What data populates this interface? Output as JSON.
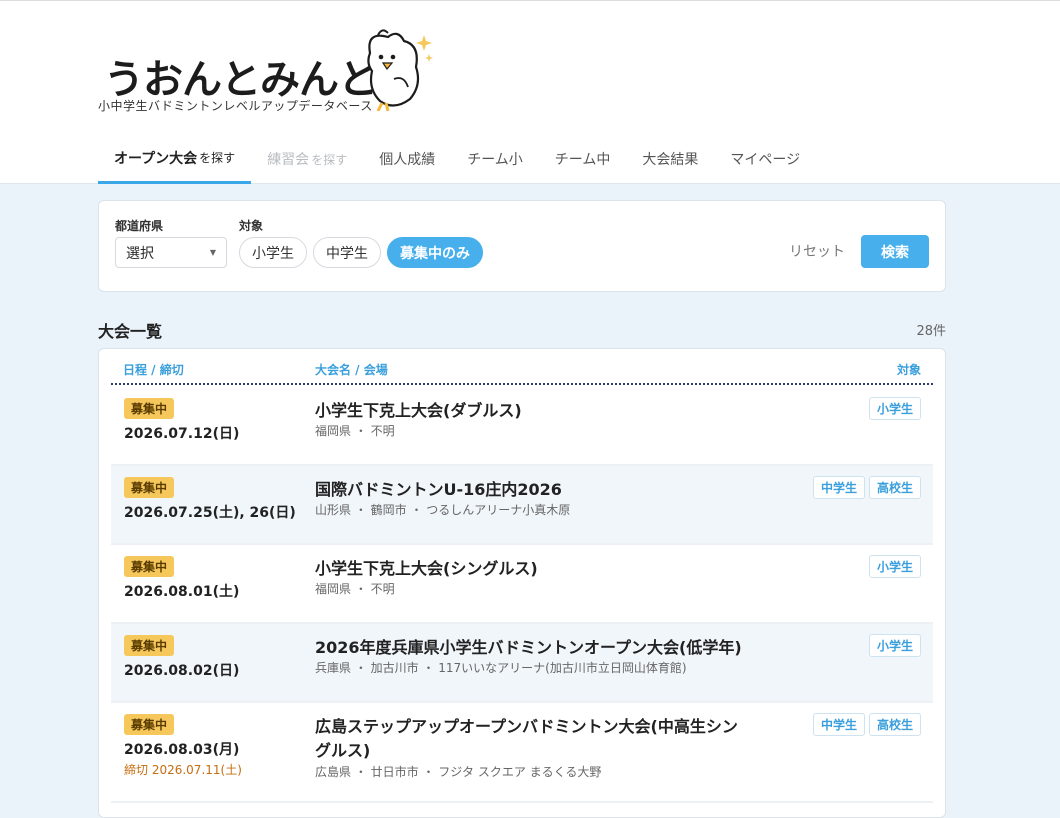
{
  "brand": {
    "logo_text": "うおんとみんとん",
    "subtitle": "小中学生バドミントンレベルアップデータベース"
  },
  "nav": [
    {
      "main": "オープン大会",
      "suffix": "を探す",
      "state": "active"
    },
    {
      "main": "練習会",
      "suffix": "を探す",
      "state": "disabled"
    },
    {
      "main": "個人成績",
      "suffix": "",
      "state": "normal"
    },
    {
      "main": "チーム小",
      "suffix": "",
      "state": "normal"
    },
    {
      "main": "チーム中",
      "suffix": "",
      "state": "normal"
    },
    {
      "main": "大会結果",
      "suffix": "",
      "state": "normal"
    },
    {
      "main": "マイページ",
      "suffix": "",
      "state": "normal"
    }
  ],
  "filter": {
    "prefecture_label": "都道府県",
    "prefecture_value": "選択",
    "target_label": "対象",
    "chips": [
      {
        "label": "小学生",
        "selected": false
      },
      {
        "label": "中学生",
        "selected": false
      },
      {
        "label": "募集中のみ",
        "selected": true
      }
    ],
    "reset_label": "リセット",
    "search_label": "検索"
  },
  "list": {
    "title": "大会一覧",
    "count": "28件",
    "headers": {
      "date": "日程 / 締切",
      "name": "大会名 / 会場",
      "target": "対象"
    },
    "rows": [
      {
        "badge": "募集中",
        "date": "2026.07.12(日)",
        "deadline": "",
        "name": "小学生下克上大会(ダブルス)",
        "venue": "福岡県 ・ 不明",
        "tags": [
          "小学生"
        ]
      },
      {
        "badge": "募集中",
        "date": "2026.07.25(土), 26(日)",
        "deadline": "",
        "name": "国際バドミントンU-16庄内2026",
        "venue": "山形県 ・ 鶴岡市 ・ つるしんアリーナ小真木原",
        "tags": [
          "中学生",
          "高校生"
        ]
      },
      {
        "badge": "募集中",
        "date": "2026.08.01(土)",
        "deadline": "",
        "name": "小学生下克上大会(シングルス)",
        "venue": "福岡県 ・ 不明",
        "tags": [
          "小学生"
        ]
      },
      {
        "badge": "募集中",
        "date": "2026.08.02(日)",
        "deadline": "",
        "name": "2026年度兵庫県小学生バドミントンオープン大会(低学年)",
        "venue": "兵庫県 ・ 加古川市 ・ 117いいなアリーナ(加古川市立日岡山体育館)",
        "tags": [
          "小学生"
        ]
      },
      {
        "badge": "募集中",
        "date": "2026.08.03(月)",
        "deadline": "締切 2026.07.11(土)",
        "name": "広島ステップアップオープンバドミントン大会(中高生シングルス)",
        "venue": "広島県 ・ 廿日市市 ・ フジタ スクエア まるくる大野",
        "tags": [
          "中学生",
          "高校生"
        ]
      }
    ]
  }
}
